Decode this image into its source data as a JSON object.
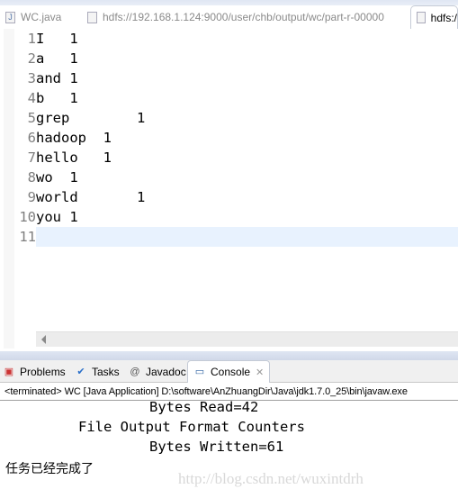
{
  "editor_tabs": [
    {
      "label": "WC.java",
      "icon": "java-file-icon",
      "active": false
    },
    {
      "label": "hdfs://192.168.1.124:9000/user/chb/output/wc/part-r-00000",
      "icon": "text-file-icon",
      "active": false
    },
    {
      "label": "hdfs:/",
      "icon": "text-file-icon",
      "active": true
    }
  ],
  "editor": {
    "current_line": 11,
    "lines": [
      {
        "n": "1",
        "text": "I\t1"
      },
      {
        "n": "2",
        "text": "a\t1"
      },
      {
        "n": "3",
        "text": "and\t1"
      },
      {
        "n": "4",
        "text": "b\t1"
      },
      {
        "n": "5",
        "text": "grep\t\t1"
      },
      {
        "n": "6",
        "text": "hadoop\t1"
      },
      {
        "n": "7",
        "text": "hello\t1"
      },
      {
        "n": "8",
        "text": "wo\t1"
      },
      {
        "n": "9",
        "text": "world\t\t1"
      },
      {
        "n": "10",
        "text": "you\t1"
      },
      {
        "n": "11",
        "text": ""
      }
    ]
  },
  "panel_tabs": [
    {
      "label": "Problems",
      "icon": "problems-icon"
    },
    {
      "label": "Tasks",
      "icon": "tasks-icon"
    },
    {
      "label": "Javadoc",
      "icon": "at-icon"
    },
    {
      "label": "Console",
      "icon": "console-icon",
      "active": true
    }
  ],
  "console": {
    "header": "<terminated> WC [Java Application] D:\\software\\AnZhuangDir\\Java\\jdk1.7.0_25\\bin\\javaw.exe",
    "output": [
      "Bytes Read=42",
      "File Output Format Counters",
      "Bytes Written=61"
    ],
    "message": "任务已经完成了"
  },
  "watermark": "http://blog.csdn.net/wuxintdrh",
  "colors": {
    "current_line": "#e8f2fe",
    "line_number": "#7f7f7f"
  }
}
